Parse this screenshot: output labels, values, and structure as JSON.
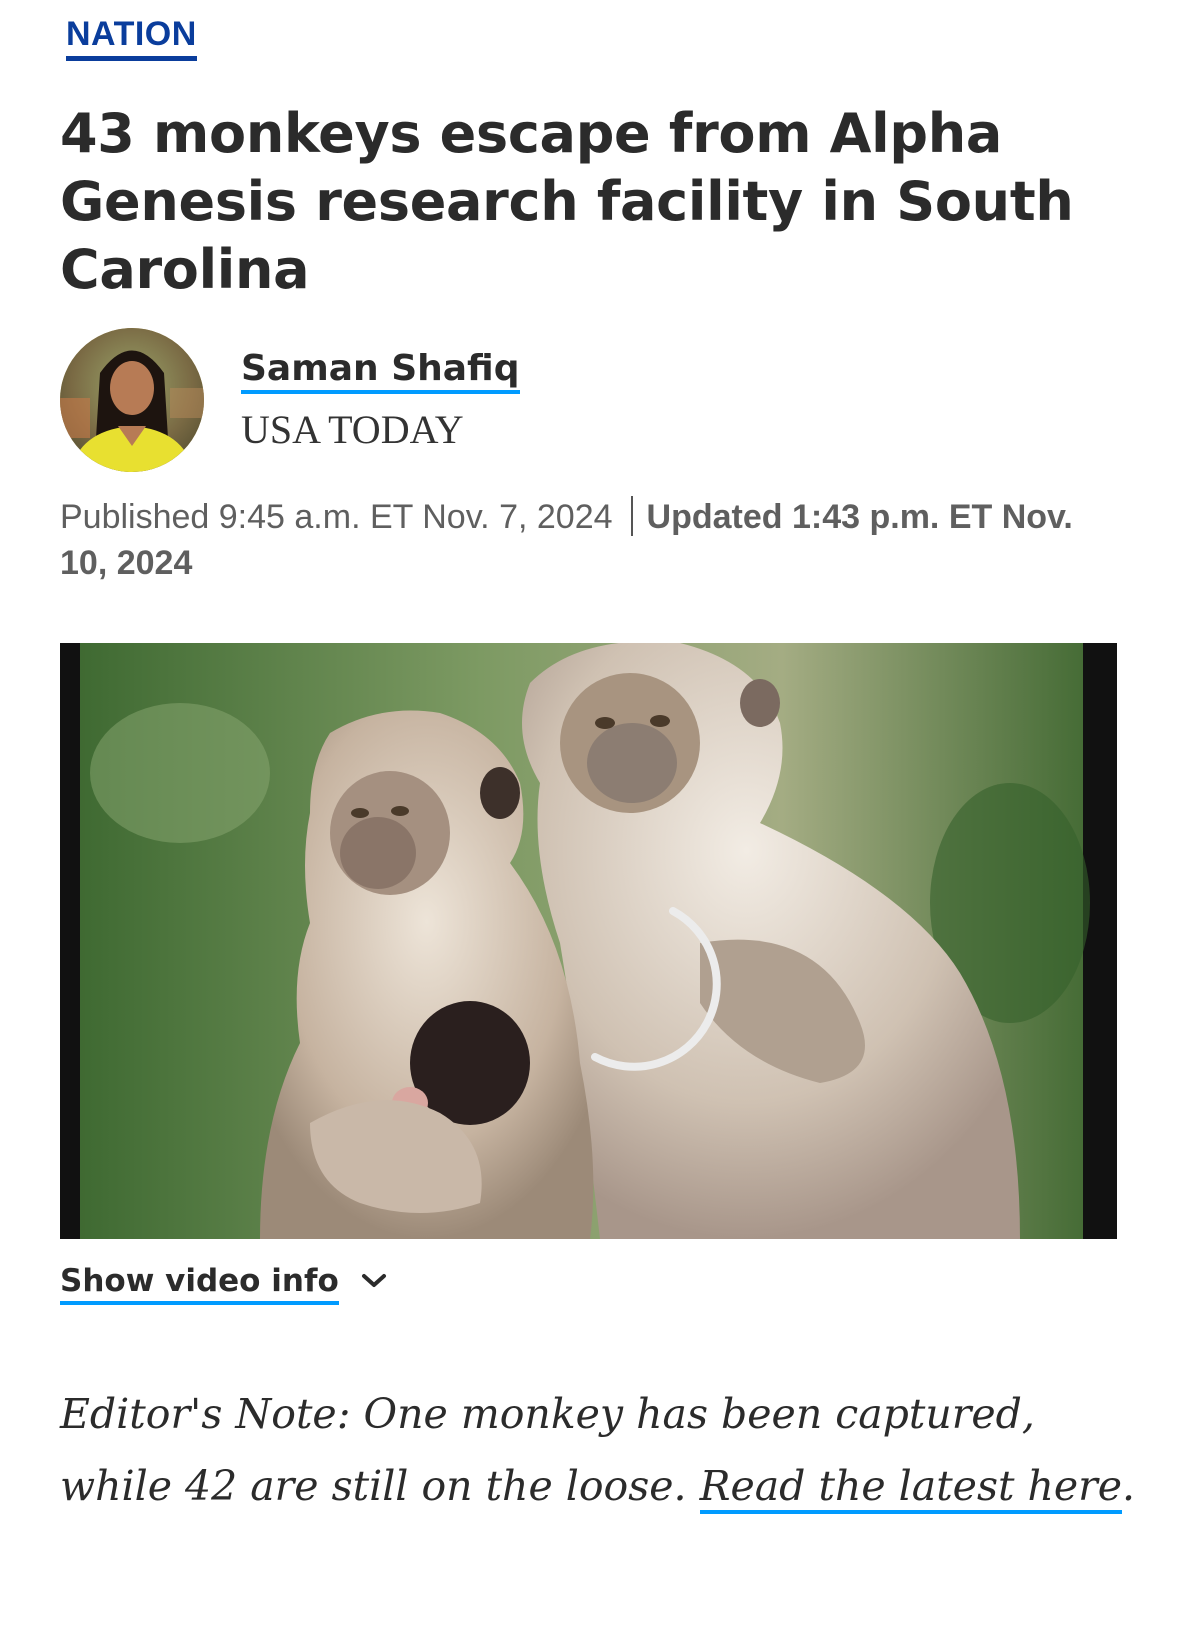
{
  "section": {
    "label": "NATION"
  },
  "headline": "43 monkeys escape from Alpha Genesis research facility in South Carolina",
  "byline": {
    "author_name": "Saman Shafiq",
    "organization": "USA TODAY"
  },
  "dateline": {
    "published": "Published 9:45 a.m. ET Nov. 7, 2024",
    "updated": "Updated 1:43 p.m. ET Nov. 10, 2024"
  },
  "video": {
    "state": "loading"
  },
  "video_info": {
    "label": "Show video info",
    "icon": "chevron-down-icon"
  },
  "editors_note": {
    "text": "Editor's Note: One monkey has been captured, while 42 are still on the loose. ",
    "link_text": "Read the latest here",
    "trailing": "."
  },
  "colors": {
    "section": "#0a3d9c",
    "link_underline": "#009bff",
    "text": "#2b2b2b"
  }
}
